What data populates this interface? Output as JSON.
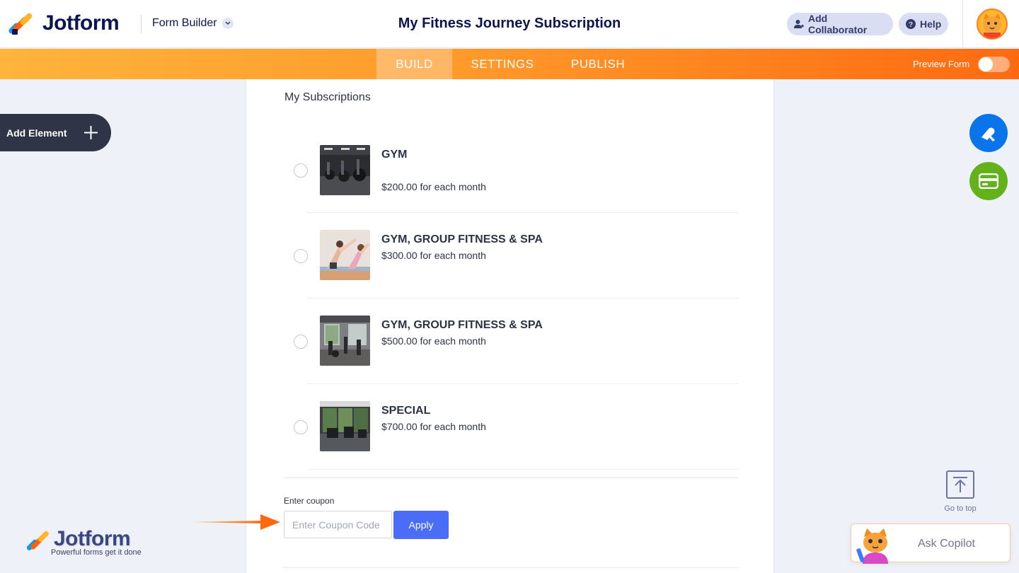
{
  "header": {
    "brand": "Jotform",
    "builder_label": "Form Builder",
    "form_title": "My Fitness Journey Subscription",
    "add_collaborator": "Add Collaborator",
    "help": "Help"
  },
  "nav": {
    "tabs": [
      {
        "label": "BUILD",
        "active": true
      },
      {
        "label": "SETTINGS",
        "active": false
      },
      {
        "label": "PUBLISH",
        "active": false
      }
    ],
    "preview_label": "Preview Form",
    "preview_on": false
  },
  "sidebar": {
    "add_element": "Add Element"
  },
  "form": {
    "section_title": "My Subscriptions",
    "products": [
      {
        "name": "GYM",
        "price": "$200.00 for each month"
      },
      {
        "name": "GYM, GROUP FITNESS & SPA",
        "price": "$300.00 for each month"
      },
      {
        "name": "GYM, GROUP FITNESS & SPA",
        "price": "$500.00 for each month"
      },
      {
        "name": "SPECIAL",
        "price": "$700.00 for each month"
      }
    ],
    "coupon_label": "Enter coupon",
    "coupon_placeholder": "Enter Coupon Code",
    "coupon_value": "",
    "apply_label": "Apply"
  },
  "right": {
    "go_to_top": "Go to top",
    "ask_copilot": "Ask Copilot"
  },
  "watermark": {
    "brand": "Jotform",
    "tagline": "Powerful forms get it done"
  },
  "colors": {
    "accent_orange": "#ff6a10",
    "brand_navy": "#0a1551",
    "apply_blue": "#4a6cf7",
    "fab_blue": "#0a75eb",
    "fab_green": "#64b21b"
  }
}
